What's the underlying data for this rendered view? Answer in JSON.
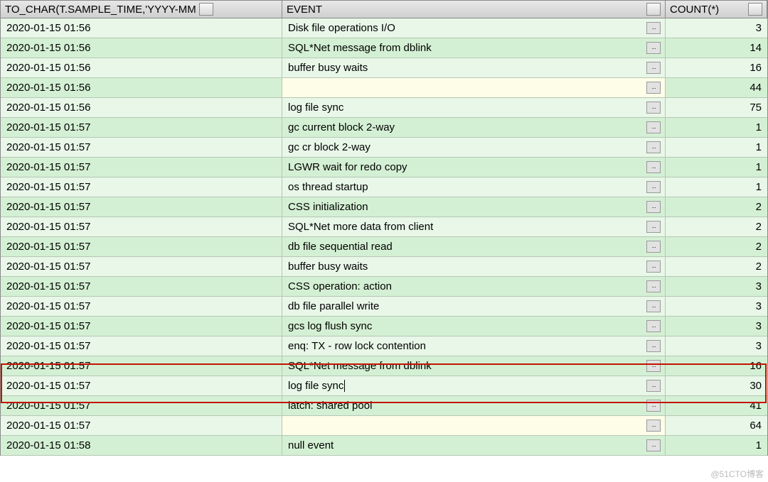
{
  "columns": {
    "sample_time": "TO_CHAR(T.SAMPLE_TIME,'YYYY-MM",
    "event": "EVENT",
    "count": "COUNT(*)"
  },
  "rows": [
    {
      "time": "2020-01-15 01:56",
      "event": "Disk file operations I/O",
      "count": "3",
      "shade": "even"
    },
    {
      "time": "2020-01-15 01:56",
      "event": "SQL*Net message from dblink",
      "count": "14",
      "shade": "odd"
    },
    {
      "time": "2020-01-15 01:56",
      "event": "buffer busy waits",
      "count": "16",
      "shade": "even"
    },
    {
      "time": "2020-01-15 01:56",
      "event": "",
      "count": "44",
      "shade": "odd",
      "null_ev": true
    },
    {
      "time": "2020-01-15 01:56",
      "event": "log file sync",
      "count": "75",
      "shade": "even"
    },
    {
      "time": "2020-01-15 01:57",
      "event": "gc current block 2-way",
      "count": "1",
      "shade": "odd"
    },
    {
      "time": "2020-01-15 01:57",
      "event": "gc cr block 2-way",
      "count": "1",
      "shade": "even"
    },
    {
      "time": "2020-01-15 01:57",
      "event": "LGWR wait for redo copy",
      "count": "1",
      "shade": "odd"
    },
    {
      "time": "2020-01-15 01:57",
      "event": "os thread startup",
      "count": "1",
      "shade": "even"
    },
    {
      "time": "2020-01-15 01:57",
      "event": "CSS initialization",
      "count": "2",
      "shade": "odd"
    },
    {
      "time": "2020-01-15 01:57",
      "event": "SQL*Net more data from client",
      "count": "2",
      "shade": "even"
    },
    {
      "time": "2020-01-15 01:57",
      "event": "db file sequential read",
      "count": "2",
      "shade": "odd"
    },
    {
      "time": "2020-01-15 01:57",
      "event": "buffer busy waits",
      "count": "2",
      "shade": "even"
    },
    {
      "time": "2020-01-15 01:57",
      "event": "CSS operation: action",
      "count": "3",
      "shade": "odd"
    },
    {
      "time": "2020-01-15 01:57",
      "event": "db file parallel write",
      "count": "3",
      "shade": "even"
    },
    {
      "time": "2020-01-15 01:57",
      "event": "gcs log flush sync",
      "count": "3",
      "shade": "odd"
    },
    {
      "time": "2020-01-15 01:57",
      "event": "enq: TX - row lock contention",
      "count": "3",
      "shade": "even"
    },
    {
      "time": "2020-01-15 01:57",
      "event": "SQL*Net message from dblink",
      "count": "16",
      "shade": "odd"
    },
    {
      "time": "2020-01-15 01:57",
      "event": "log file sync",
      "count": "30",
      "shade": "even",
      "cursor": true
    },
    {
      "time": "2020-01-15 01:57",
      "event": "latch: shared pool",
      "count": "41",
      "shade": "odd"
    },
    {
      "time": "2020-01-15 01:57",
      "event": "",
      "count": "64",
      "shade": "even",
      "null_ev": true
    },
    {
      "time": "2020-01-15 01:58",
      "event": "null event",
      "count": "1",
      "shade": "odd"
    }
  ],
  "watermark": "@51CTO博客",
  "highlight": {
    "startRow": 18,
    "endRow": 19
  }
}
